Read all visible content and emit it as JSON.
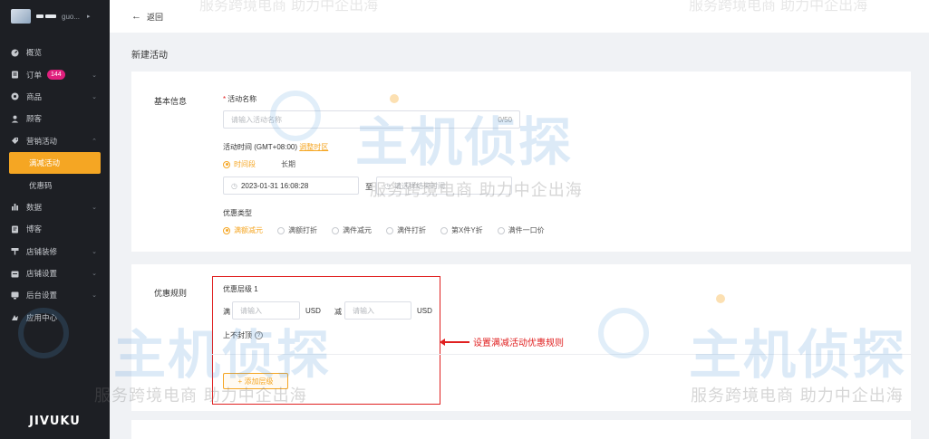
{
  "app": {
    "store_name": "guo...",
    "footer_logo": "JIVUKU"
  },
  "topbar": {
    "back_label": "返回"
  },
  "sidebar": {
    "items": [
      {
        "label": "概览",
        "icon": "dashboard-icon"
      },
      {
        "label": "订单",
        "icon": "order-icon",
        "badge": "144"
      },
      {
        "label": "商品",
        "icon": "product-icon"
      },
      {
        "label": "顾客",
        "icon": "user-icon"
      },
      {
        "label": "营销活动",
        "icon": "tag-icon"
      },
      {
        "label": "满减活动",
        "active": true
      },
      {
        "label": "优惠码"
      },
      {
        "label": "数据",
        "icon": "chart-icon"
      },
      {
        "label": "博客",
        "icon": "blog-icon"
      },
      {
        "label": "店铺装修",
        "icon": "paint-icon"
      },
      {
        "label": "店铺设置",
        "icon": "store-icon"
      },
      {
        "label": "后台设置",
        "icon": "settings-icon"
      },
      {
        "label": "应用中心",
        "icon": "app-icon"
      }
    ]
  },
  "page": {
    "title": "新建活动"
  },
  "basic": {
    "section_label": "基本信息",
    "name_label": "活动名称",
    "name_placeholder": "请输入活动名称",
    "name_counter": "0/50",
    "time_label": "活动时间 (GMT+08:00)",
    "time_hint": "调整时区",
    "time_options": [
      "时间段",
      "长期"
    ],
    "start_value": "2023-01-31 16:08:28",
    "to_label": "至",
    "end_placeholder": "请选择结束时间",
    "type_label": "优惠类型",
    "type_options": [
      "满额减元",
      "满额打折",
      "满件减元",
      "满件打折",
      "第X件Y折",
      "满件一口价"
    ]
  },
  "rules": {
    "section_label": "优惠规则",
    "level_label": "优惠层级 1",
    "full_label": "满",
    "full_placeholder": "请输入",
    "currency_1": "USD",
    "minus_label": "减",
    "minus_placeholder": "请输入",
    "currency_2": "USD",
    "no_cap_label": "上不封顶",
    "help_icon_text": "?",
    "add_level_label": "+ 添加层级"
  },
  "annotation": {
    "text": "设置满减活动优惠规则"
  },
  "watermark": {
    "main_text": "主机侦探",
    "sub_text": "服务跨境电商 助力中企出海",
    "top_text": "服务跨境电商 助力中企出海"
  },
  "colors": {
    "accent": "#f5a623",
    "sidebar_bg": "#1d1f24",
    "badge": "#e0207d",
    "annotation": "#e02020"
  }
}
